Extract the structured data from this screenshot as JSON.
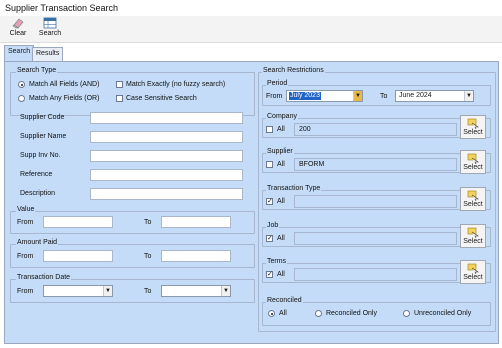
{
  "window": {
    "title": "Supplier Transaction Search"
  },
  "toolbar": {
    "clear": "Clear",
    "search": "Search"
  },
  "tabs": [
    "Search",
    "Results"
  ],
  "search_type": {
    "legend": "Search Type",
    "match_all": "Match All Fields (AND)",
    "match_any": "Match Any Fields (OR)",
    "match_exactly": "Match Exactly (no fuzzy search)",
    "case_sensitive": "Case Sensitive Search"
  },
  "fields": {
    "supplier_code": "Supplier Code",
    "supplier_name": "Supplier Name",
    "supp_inv_no": "Supp Inv No.",
    "reference": "Reference",
    "description": "Description"
  },
  "value": {
    "legend": "Value",
    "from": "From",
    "to": "To"
  },
  "amount_paid": {
    "legend": "Amount Paid",
    "from": "From",
    "to": "To"
  },
  "transaction_date": {
    "legend": "Transaction Date",
    "from": "From",
    "to": "To"
  },
  "restrictions": {
    "legend": "Search Restrictions",
    "period": {
      "legend": "Period",
      "from_label": "From",
      "from_value": "July 2023",
      "to_label": "To",
      "to_value": "June 2024"
    },
    "company": {
      "legend": "Company",
      "all": "All",
      "value": "200"
    },
    "supplier": {
      "legend": "Supplier",
      "all": "All",
      "value": "BFORM"
    },
    "transaction_type": {
      "legend": "Transaction Type",
      "all": "All"
    },
    "job": {
      "legend": "Job",
      "all": "All"
    },
    "terms": {
      "legend": "Terms",
      "all": "All"
    },
    "select_label": "Select"
  },
  "reconciled": {
    "legend": "Reconciled",
    "all": "All",
    "only": "Reconciled Only",
    "unreconciled": "Unreconciled Only"
  }
}
